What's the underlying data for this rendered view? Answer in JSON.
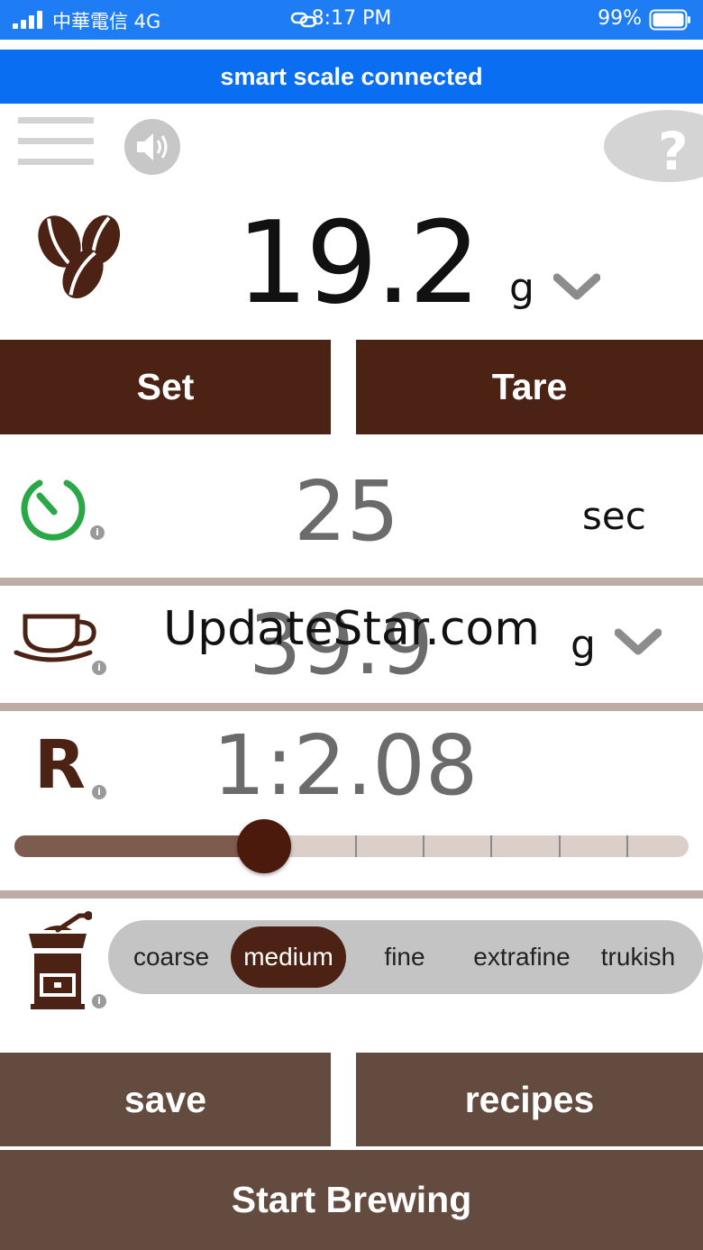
{
  "status_bar": {
    "carrier": "中華電信  4G",
    "time": "8:17 PM",
    "battery": "99%"
  },
  "banner": {
    "text": "smart scale connected"
  },
  "toolbar": {
    "menu_icon": "hamburger-menu-icon",
    "sound_icon": "speaker-icon",
    "help_icon": "question-icon"
  },
  "weight": {
    "value": "19.2",
    "unit": "g",
    "icon": "coffee-beans-icon"
  },
  "buttons": {
    "set": "Set",
    "tare": "Tare",
    "save": "save",
    "recipes": "recipes",
    "start": "Start Brewing"
  },
  "timer": {
    "value": "25",
    "unit": "sec",
    "icon": "timer-icon",
    "info": "i"
  },
  "output": {
    "value": "39.9",
    "unit": "g",
    "icon": "coffee-cup-icon",
    "info": "i"
  },
  "ratio": {
    "label": "R",
    "value": "1:2.08",
    "slider_fraction": 0.37,
    "info": "i"
  },
  "grind": {
    "icon": "coffee-grinder-icon",
    "info": "i",
    "options": [
      "coarse",
      "medium",
      "fine",
      "extrafine",
      "trukish"
    ],
    "selected": "medium"
  },
  "watermark": "UpdateStar.com",
  "colors": {
    "status_blue": "#1e7df5",
    "banner_blue": "#0a6ef2",
    "brown_dark": "#4b2213",
    "brown_mid": "#644b40",
    "divider": "#bfaca4",
    "timer_green": "#2aa746"
  }
}
